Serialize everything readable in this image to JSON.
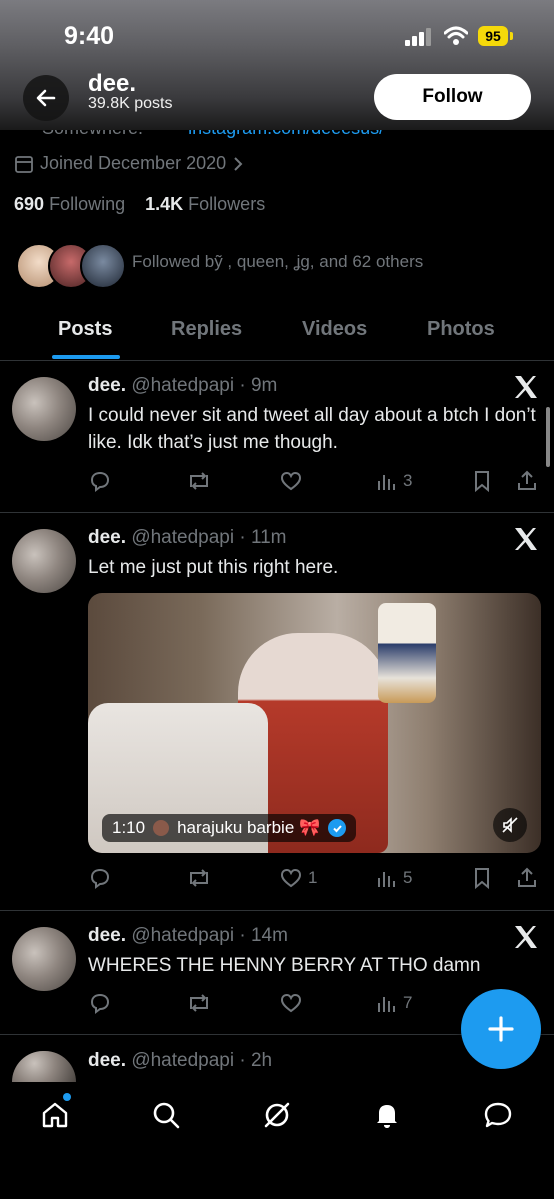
{
  "status": {
    "time": "9:40",
    "battery": "95"
  },
  "header": {
    "name": "dee.",
    "posts": "39.8K posts",
    "follow_label": "Follow"
  },
  "profile": {
    "location_cut": "Somewhere.",
    "link_cut": "instagram.com/deeesus/",
    "joined": "Joined December 2020",
    "following_count": "690",
    "following_label": "Following",
    "followers_count": "1.4K",
    "followers_label": "Followers",
    "followed_by": "Followed bỹ , queen, ʝɡ, and 62 others"
  },
  "tabs": [
    "Posts",
    "Replies",
    "Videos",
    "Photos"
  ],
  "tweets": [
    {
      "name": "dee.",
      "handle_time": "@hatedpapi · 9m",
      "text": "I could never sit and tweet all day about a btch I don’t like. Idk that’s just me though.",
      "likes": "",
      "views": "3"
    },
    {
      "name": "dee.",
      "handle_time": "@hatedpapi · 11m",
      "text": "Let me just put this right here.",
      "video_duration": "1:10",
      "video_user": "harajuku barbie 🎀",
      "likes": "1",
      "views": "5"
    },
    {
      "name": "dee.",
      "handle_time": "@hatedpapi · 14m",
      "text": "WHERES THE HENNY BERRY AT THO damn",
      "views": "7"
    },
    {
      "name": "dee.",
      "handle_time": "@hatedpapi · 2h"
    }
  ],
  "icons": {
    "back": "arrow-left-icon",
    "calendar": "calendar-icon",
    "x": "x-logo-icon",
    "reply": "reply-icon",
    "repost": "repost-icon",
    "like": "heart-icon",
    "views": "views-icon",
    "bookmark": "bookmark-icon",
    "share": "share-icon",
    "compose": "plus-icon",
    "home": "home-icon",
    "search": "search-icon",
    "grok": "grok-icon",
    "notifications": "bell-icon",
    "messages": "message-icon"
  },
  "colors": {
    "accent": "#1d9bf0",
    "muted": "#71767b",
    "text": "#e7e9ea",
    "battery": "#f5d90a"
  }
}
